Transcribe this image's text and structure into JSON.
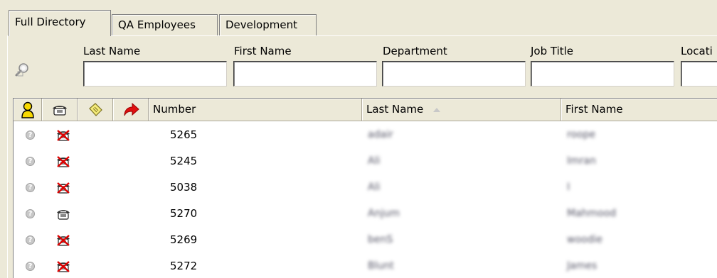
{
  "tabs": [
    {
      "label": "Full Directory"
    },
    {
      "label": "QA Employees"
    },
    {
      "label": "Development"
    }
  ],
  "filters": {
    "labels": [
      "Last Name",
      "First Name",
      "Department",
      "Job Title",
      "Locati"
    ]
  },
  "grid": {
    "columns": [
      "Number",
      "Last Name",
      "First Name"
    ],
    "sorted_by": "Last Name",
    "rows": [
      {
        "number": "5265",
        "last": "adair",
        "first": "roope",
        "phone_status": "unavailable"
      },
      {
        "number": "5245",
        "last": "Ali",
        "first": "Imran",
        "phone_status": "unavailable"
      },
      {
        "number": "5038",
        "last": "Ali",
        "first": "I",
        "phone_status": "unavailable"
      },
      {
        "number": "5270",
        "last": "Anjum",
        "first": "Mahmood",
        "phone_status": "available"
      },
      {
        "number": "5269",
        "last": "benS",
        "first": "woodie",
        "phone_status": "unavailable"
      },
      {
        "number": "5272",
        "last": "Blunt",
        "first": "James",
        "phone_status": "unavailable"
      }
    ]
  },
  "icons": {
    "search": "search-icon",
    "presence": "user-presence-icon",
    "phone": "phone-icon",
    "note": "note-icon",
    "forward": "call-forward-icon"
  },
  "colors": {
    "window_bg": "#ece9d8",
    "phone_unavailable": "#e00000",
    "presence_icon": "#f7d800"
  }
}
